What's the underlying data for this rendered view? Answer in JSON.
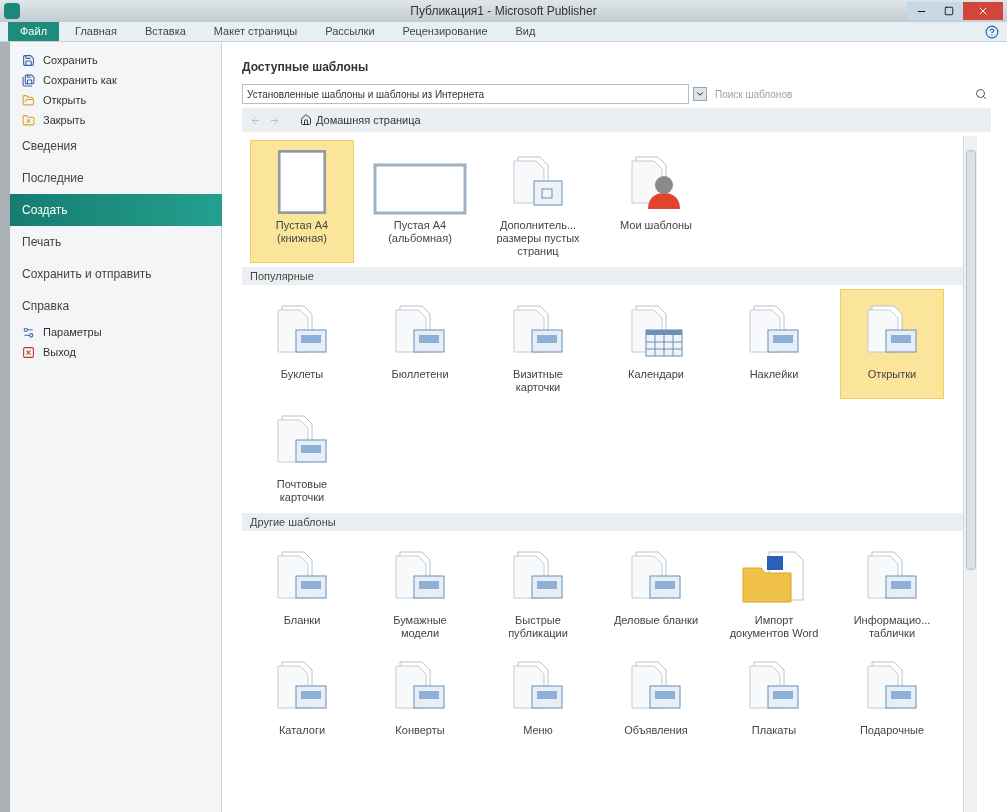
{
  "window": {
    "title": "Публикация1 - Microsoft Publisher"
  },
  "ribbon_tabs": [
    {
      "label": "Файл",
      "selected": true
    },
    {
      "label": "Главная",
      "selected": false
    },
    {
      "label": "Вставка",
      "selected": false
    },
    {
      "label": "Макет страницы",
      "selected": false
    },
    {
      "label": "Рассылки",
      "selected": false
    },
    {
      "label": "Рецензирование",
      "selected": false
    },
    {
      "label": "Вид",
      "selected": false
    }
  ],
  "sidebar": {
    "items": [
      {
        "label": "Сохранить",
        "kind": "command",
        "selected": false
      },
      {
        "label": "Сохранить как",
        "kind": "command",
        "selected": false
      },
      {
        "label": "Открыть",
        "kind": "command",
        "selected": false
      },
      {
        "label": "Закрыть",
        "kind": "command",
        "selected": false
      },
      {
        "label": "Сведения",
        "kind": "section",
        "selected": false
      },
      {
        "label": "Последние",
        "kind": "section",
        "selected": false
      },
      {
        "label": "Создать",
        "kind": "section",
        "selected": true
      },
      {
        "label": "Печать",
        "kind": "section",
        "selected": false
      },
      {
        "label": "Сохранить и отправить",
        "kind": "section",
        "selected": false
      },
      {
        "label": "Справка",
        "kind": "section",
        "selected": false
      },
      {
        "label": "Параметры",
        "kind": "command",
        "selected": false
      },
      {
        "label": "Выход",
        "kind": "command",
        "selected": false
      }
    ]
  },
  "main": {
    "heading": "Доступные шаблоны",
    "source_dropdown": {
      "value": "Установленные шаблоны и шаблоны из Интернета"
    },
    "search": {
      "placeholder": "Поиск шаблонов"
    },
    "nav": {
      "home_label": "Домашняя страница"
    },
    "groups": [
      {
        "tiles": [
          {
            "label": "Пустая A4 (книжная)",
            "kind": "blank-portrait",
            "selected": true
          },
          {
            "label": "Пустая A4 (альбомная)",
            "kind": "blank-landscape",
            "selected": false
          },
          {
            "label": "Дополнитель... размеры пустых страниц",
            "kind": "sizes",
            "selected": false
          },
          {
            "label": "Мои шаблоны",
            "kind": "person",
            "selected": false
          }
        ]
      },
      {
        "title": "Популярные",
        "tiles": [
          {
            "label": "Буклеты",
            "kind": "document",
            "selected": false
          },
          {
            "label": "Бюллетени",
            "kind": "document",
            "selected": false
          },
          {
            "label": "Визитные карточки",
            "kind": "document",
            "selected": false
          },
          {
            "label": "Календари",
            "kind": "calendar",
            "selected": false
          },
          {
            "label": "Наклейки",
            "kind": "document",
            "selected": false
          },
          {
            "label": "Открытки",
            "kind": "document",
            "selected": true
          },
          {
            "label": "Почтовые карточки",
            "kind": "document",
            "selected": false
          }
        ]
      },
      {
        "title": "Другие шаблоны",
        "tiles": [
          {
            "label": "Бланки",
            "kind": "document",
            "selected": false
          },
          {
            "label": "Бумажные модели",
            "kind": "document",
            "selected": false
          },
          {
            "label": "Быстрые публикации",
            "kind": "document",
            "selected": false
          },
          {
            "label": "Деловые бланки",
            "kind": "document",
            "selected": false
          },
          {
            "label": "Импорт документов Word",
            "kind": "folder",
            "selected": false
          },
          {
            "label": "Информацио... таблички",
            "kind": "document",
            "selected": false
          },
          {
            "label": "Каталоги",
            "kind": "document",
            "selected": false
          },
          {
            "label": "Конверты",
            "kind": "document",
            "selected": false
          },
          {
            "label": "Меню",
            "kind": "document",
            "selected": false
          },
          {
            "label": "Объявления",
            "kind": "document",
            "selected": false
          },
          {
            "label": "Плакаты",
            "kind": "document",
            "selected": false
          },
          {
            "label": "Подарочные",
            "kind": "document",
            "selected": false
          }
        ]
      }
    ]
  }
}
